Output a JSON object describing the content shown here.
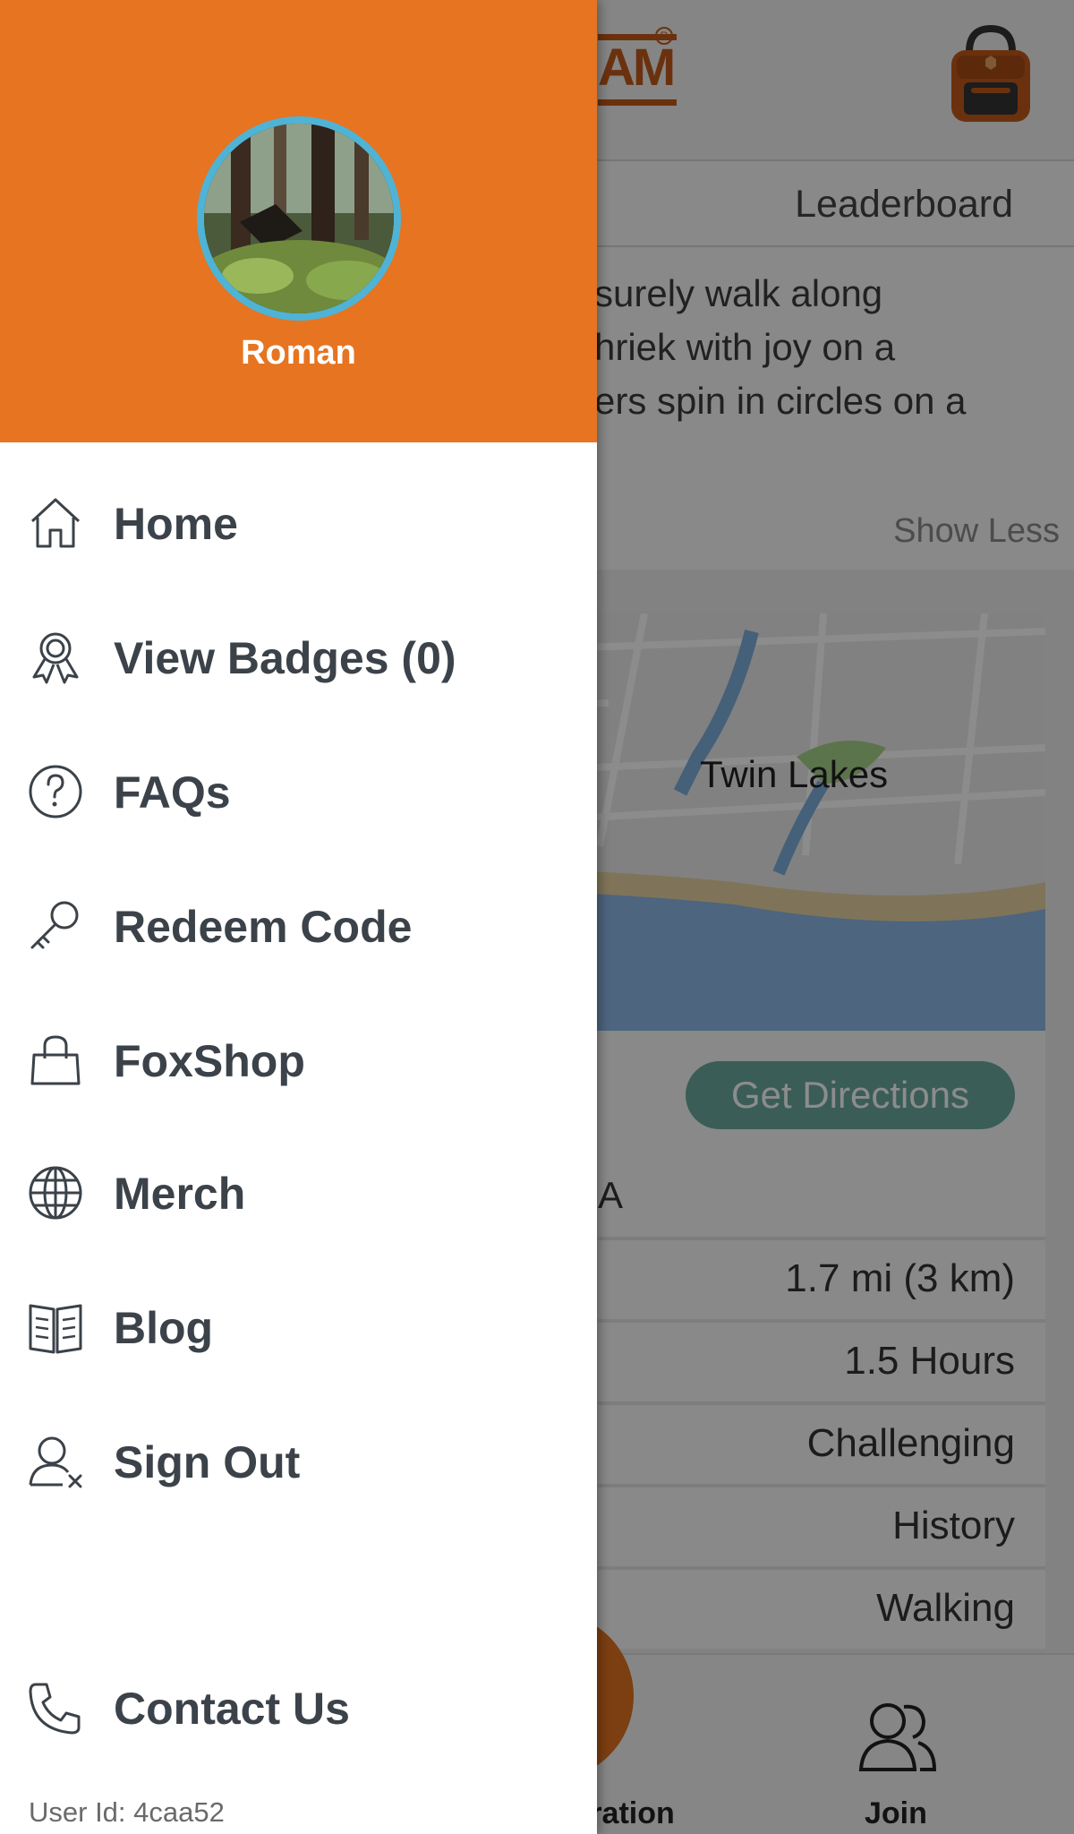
{
  "background": {
    "logo_text": "AM",
    "logo_registered": "R",
    "tabs": {
      "leaderboard": "Leaderboard"
    },
    "description_lines": [
      "surely walk along",
      "hriek with joy on a",
      "ers spin in circles on a"
    ],
    "show_less": "Show Less",
    "map": {
      "label": "Twin Lakes"
    },
    "directions_button": "Get Directions",
    "location_fragment": "A",
    "stats": [
      {
        "value": "1.7 mi (3 km)"
      },
      {
        "value": "1.5 Hours"
      },
      {
        "value": "Challenging"
      },
      {
        "value": "History"
      },
      {
        "value": "Walking"
      }
    ],
    "bottom_nav": {
      "registration": "tration",
      "join": "Join"
    }
  },
  "drawer": {
    "user_name": "Roman",
    "menu": [
      {
        "label": "Home",
        "icon": "home-icon"
      },
      {
        "label": "View Badges (0)",
        "icon": "badge-icon"
      },
      {
        "label": "FAQs",
        "icon": "question-icon"
      },
      {
        "label": "Redeem Code",
        "icon": "key-icon"
      },
      {
        "label": "FoxShop",
        "icon": "shopping-bag-icon"
      },
      {
        "label": "Merch",
        "icon": "globe-icon"
      },
      {
        "label": "Blog",
        "icon": "book-icon"
      },
      {
        "label": "Sign Out",
        "icon": "user-remove-icon"
      }
    ],
    "contact": {
      "label": "Contact Us",
      "icon": "phone-icon"
    },
    "user_id": "User Id: 4caa52"
  },
  "colors": {
    "drawer_header": "#e67421",
    "avatar_ring": "#4fb3d6",
    "menu_text": "#3b4249",
    "directions_button": "#6aa99f",
    "brand_orange": "#c35a1b"
  }
}
